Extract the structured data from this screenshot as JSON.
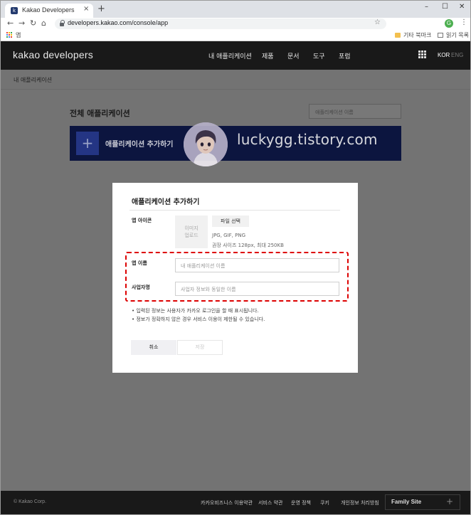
{
  "browser": {
    "tab_title": "Kakao Developers",
    "tab_favicon_letter": "k",
    "close_glyph": "×",
    "new_tab_glyph": "+",
    "window_controls": [
      "–",
      "☐",
      "✕"
    ],
    "nav_glyphs": {
      "back": "←",
      "forward": "→",
      "reload": "↻",
      "home": "⌂"
    },
    "url": "developers.kakao.com/console/app",
    "star_glyph": "☆",
    "profile_letter": "G",
    "menu_glyph": "⋮",
    "bookmarks": {
      "apps_label": "앱",
      "other_bookmarks": "기타 북마크",
      "reading_list": "읽기 목록"
    }
  },
  "header": {
    "logo": "kakao developers",
    "nav": [
      "내 애플리케이션",
      "제품",
      "문서",
      "도구",
      "포럼"
    ],
    "lang_kor": "KOR",
    "lang_eng": "ENG"
  },
  "breadcrumb": "내 애플리케이션",
  "main": {
    "title": "전체 애플리케이션",
    "search_placeholder": "애플리케이션 이름",
    "add_plus": "+",
    "add_label": "애플리케이션 추가하기"
  },
  "watermark": {
    "text": "luckygg.tistory.com"
  },
  "modal": {
    "title": "애플리케이션 추가하기",
    "app_icon_label": "앱 아이콘",
    "image_upload_line1": "이미지",
    "image_upload_line2": "업로드",
    "file_select": "파일 선택",
    "hint_formats": "JPG, GIF, PNG",
    "hint_size": "권장 사이즈 128px, 최대 250KB",
    "app_name_label": "앱 이름",
    "app_name_placeholder": "내 애플리케이션 이름",
    "company_label": "사업자명",
    "company_placeholder": "사업자 정보와 동일한 이름",
    "notes": [
      "• 입력된 정보는 사용자가 카카오 로그인을 할 때 표시됩니다.",
      "• 정보가 정확하지 않은 경우 서비스 이용이 제한될 수 있습니다."
    ],
    "cancel": "취소",
    "save": "저장"
  },
  "footer": {
    "copyright": "© Kakao Corp.",
    "links": [
      "카카오비즈니스 이용약관",
      "서비스 약관",
      "운영 정책",
      "쿠키",
      "개인정보 처리방침"
    ],
    "family_site": "Family Site",
    "family_plus": "+"
  },
  "colors": {
    "header_bg": "#191919",
    "dim_bg": "#737373",
    "banner_bg": "#0c153f",
    "highlight": "#dd0000"
  }
}
